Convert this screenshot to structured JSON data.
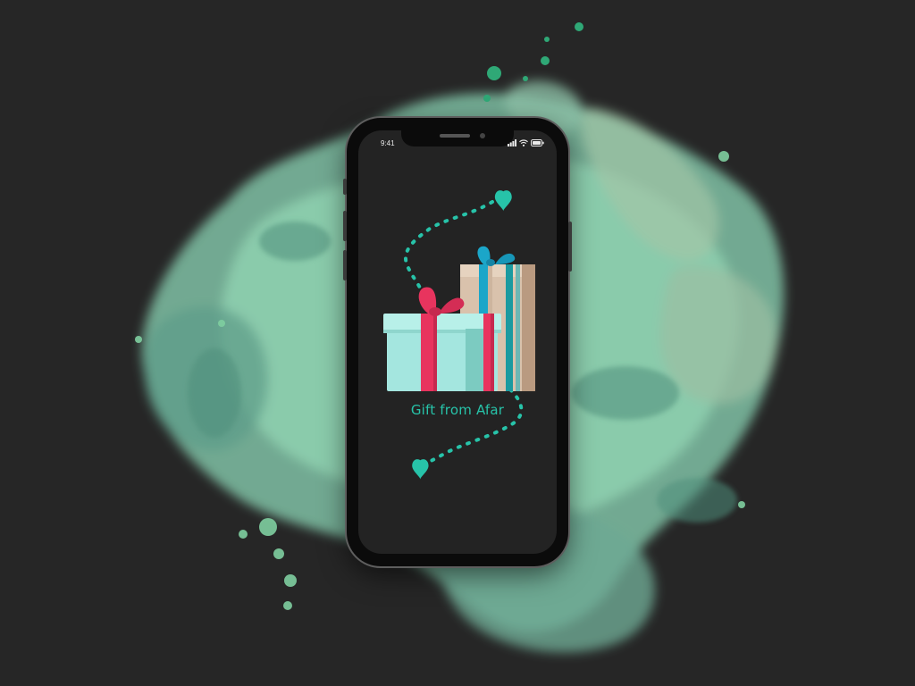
{
  "status_bar": {
    "time": "9:41",
    "icons": [
      "signal-icon",
      "wifi-icon",
      "battery-icon"
    ]
  },
  "splash_screen": {
    "title": "Gift from Afar"
  },
  "colors": {
    "background": "#262626",
    "screen": "#232323",
    "accent_teal": "#27c3a9",
    "splash_green": "#8fd1b0",
    "gift_front": "#a4e6df",
    "gift_ribbon_pink": "#e8345e",
    "gift_back": "#d9c2ac",
    "gift_ribbon_blue": "#1ba6c9"
  }
}
